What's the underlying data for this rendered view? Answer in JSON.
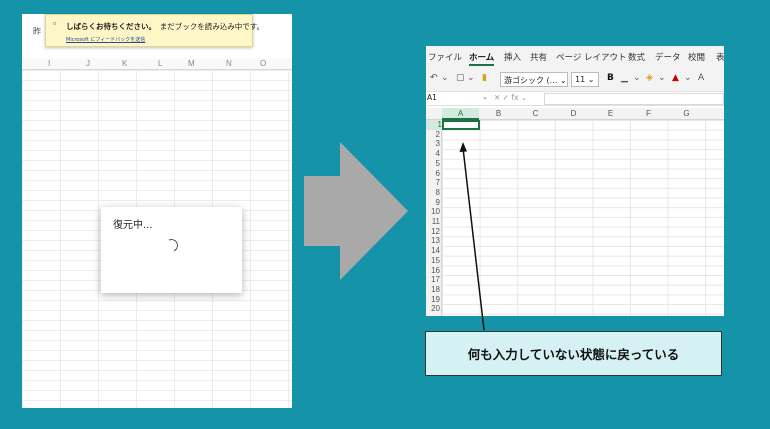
{
  "left": {
    "cutoff_text": "昨",
    "columns": [
      "I",
      "J",
      "K",
      "L",
      "M",
      "N",
      "O"
    ],
    "toast": {
      "title": "しばらくお待ちください。",
      "message": "まだブックを読み込み中です。",
      "link": "Microsoft にフィードバックを送信"
    },
    "dialog": {
      "title": "復元中..."
    }
  },
  "right": {
    "tabs": [
      "ファイル",
      "ホーム",
      "挿入",
      "共有",
      "ページ レイアウト",
      "数式",
      "データ",
      "校閲",
      "表"
    ],
    "toolbar": {
      "font_name": "游ゴシック (...",
      "font_size": "11",
      "bold_label": "B",
      "font_grow": "A"
    },
    "name_box": "A1",
    "fx_label": "fx",
    "columns": [
      "A",
      "B",
      "C",
      "D",
      "E",
      "F",
      "G"
    ],
    "rows": [
      "1",
      "2",
      "3",
      "4",
      "5",
      "6",
      "7",
      "8",
      "9",
      "10",
      "11",
      "12",
      "13",
      "14",
      "15",
      "16",
      "17",
      "18",
      "19",
      "20"
    ]
  },
  "caption": "何も入力していない状態に戻っている",
  "colors": {
    "background": "#1593a8",
    "excel_green": "#1e7145",
    "toast_bg": "#fdf6c6",
    "caption_bg": "#d6f1f3",
    "arrow": "#a9a9a9"
  }
}
